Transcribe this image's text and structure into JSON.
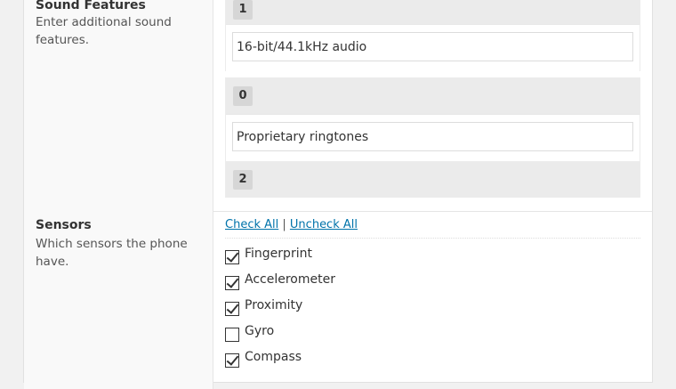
{
  "sound_features": {
    "title": "Sound Features",
    "description": "Enter additional sound features.",
    "items": [
      {
        "index": "1",
        "value": "16-bit/44.1kHz audio"
      },
      {
        "index": "0",
        "value": "Proprietary ringtones"
      },
      {
        "index": "2",
        "value": ""
      }
    ]
  },
  "sensors": {
    "title": "Sensors",
    "description": "Which sensors the phone have.",
    "check_all": "Check All",
    "separator": "|",
    "uncheck_all": "Uncheck All",
    "options": [
      {
        "label": "Fingerprint",
        "checked": true
      },
      {
        "label": "Accelerometer",
        "checked": true
      },
      {
        "label": "Proximity",
        "checked": true
      },
      {
        "label": "Gyro",
        "checked": false
      },
      {
        "label": "Compass",
        "checked": true
      }
    ]
  }
}
